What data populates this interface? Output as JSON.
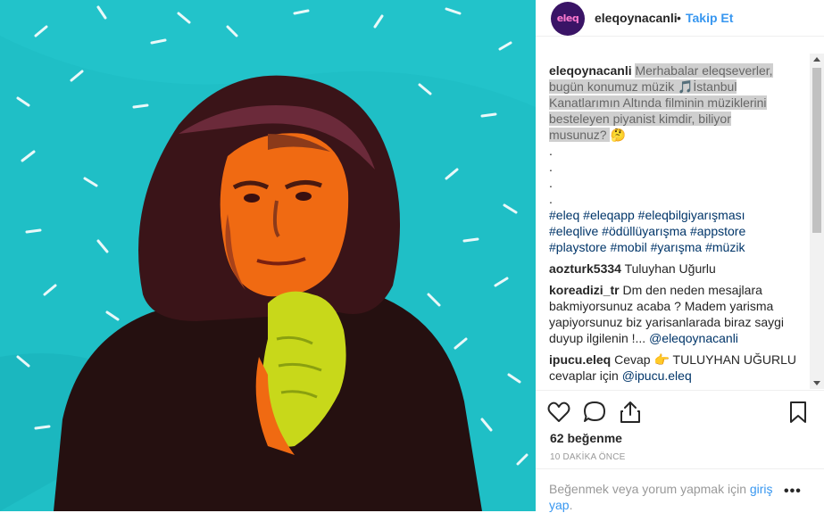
{
  "header": {
    "avatar_text": "eleq",
    "username": "eleqoynacanli",
    "separator": "•",
    "follow_label": "Takip Et"
  },
  "caption": {
    "username": "eleqoynacanli",
    "line1": "Merhabalar eleqseverler,",
    "line2a": "bugün konumuz müzik ",
    "line2b": "İstanbul",
    "line3": "Kanatlarımın Altında filminin müziklerini",
    "line4": "besteleyen piyanist kimdir, biliyor",
    "line5": "musunuz? ",
    "dots": [
      ".",
      ".",
      ".",
      "."
    ],
    "hashtags_line1": [
      "#eleq",
      "#eleqapp",
      "#eleqbilgiyarışması"
    ],
    "hashtags_line2": [
      "#eleqlive",
      "#ödüllüyarışma",
      "#appstore"
    ],
    "hashtags_line3": [
      "#playstore",
      "#mobil",
      "#yarışma",
      "#müzik"
    ]
  },
  "comments": [
    {
      "user": "aozturk5334",
      "text": "Tuluyhan Uğurlu"
    },
    {
      "user": "koreadizi_tr",
      "text": "Dm den neden mesajlara bakmiyorsunuz acaba ? Madem yarisma yapiyorsunuz biz yarisanlarada biraz saygi duyup ilgilenin !... ",
      "mention": "@eleqoynacanli"
    },
    {
      "user": "ipucu.eleq",
      "text_a": "Cevap ",
      "text_b": " TULUYHAN UĞURLU cevaplar için ",
      "mention": "@ipucu.eleq"
    }
  ],
  "likes": "62 beğenme",
  "timestamp": "10 DAKİKA ÖNCE",
  "footer": {
    "prompt": "Beğenmek veya yorum yapmak için ",
    "login_link": "giriş yap",
    "period": ".",
    "more": "•••"
  },
  "icons": {
    "like": "heart-icon",
    "comment": "comment-icon",
    "share": "share-icon",
    "save": "bookmark-icon",
    "music": "music-notes-emoji",
    "thinking": "thinking-face-emoji",
    "pointing": "pointing-hand-emoji"
  },
  "colors": {
    "photo_background": "#1fbfc6",
    "link_blue": "#3897f0",
    "hashtag": "#003569",
    "avatar": "#3a1466"
  }
}
